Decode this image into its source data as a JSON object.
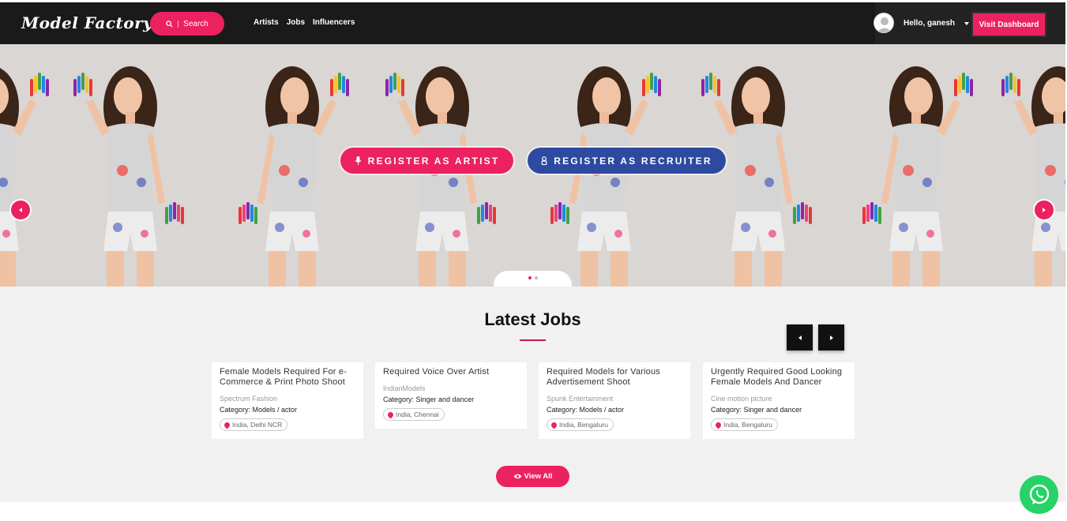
{
  "brand": {
    "logo": "Model Factory",
    "accent": "#ec2160",
    "recruiter_color": "#2e4aa0"
  },
  "header": {
    "search_label": "Search",
    "nav": [
      "Artists",
      "Jobs",
      "Influencers"
    ],
    "greeting": "Hello, ganesh",
    "dashboard_label": "Visit Dashboard"
  },
  "hero": {
    "register_artist": "REGISTER AS ARTIST",
    "register_recruiter": "REGISTER AS RECRUITER",
    "slides": 2,
    "active_slide": 1
  },
  "jobs": {
    "title": "Latest Jobs",
    "cards": [
      {
        "title": "Female Models Required For e-Commerce & Print Photo Shoot",
        "company": "Spectrum Fashion",
        "category": "Category: Models / actor",
        "location": "India, Delhi NCR"
      },
      {
        "title": "Required Voice Over Artist",
        "company": "IndianModels",
        "category": "Category: Singer and dancer",
        "location": "India, Chennai"
      },
      {
        "title": "Required Models for Various Advertisement Shoot",
        "company": "Spunk Entertainment",
        "category": "Category: Models / actor",
        "location": "India, Bengaluru"
      },
      {
        "title": "Urgently Required Good Looking Female Models And Dancer",
        "company": "Cine motion picture",
        "category": "Category: Singer and dancer",
        "location": "India, Bengaluru"
      }
    ],
    "view_all": "View All"
  },
  "icons": [
    "search-icon",
    "caret-down-icon",
    "mic-icon",
    "user-icon",
    "chevron-left-icon",
    "chevron-right-icon",
    "location-pin-icon",
    "eye-icon",
    "whatsapp-icon"
  ]
}
